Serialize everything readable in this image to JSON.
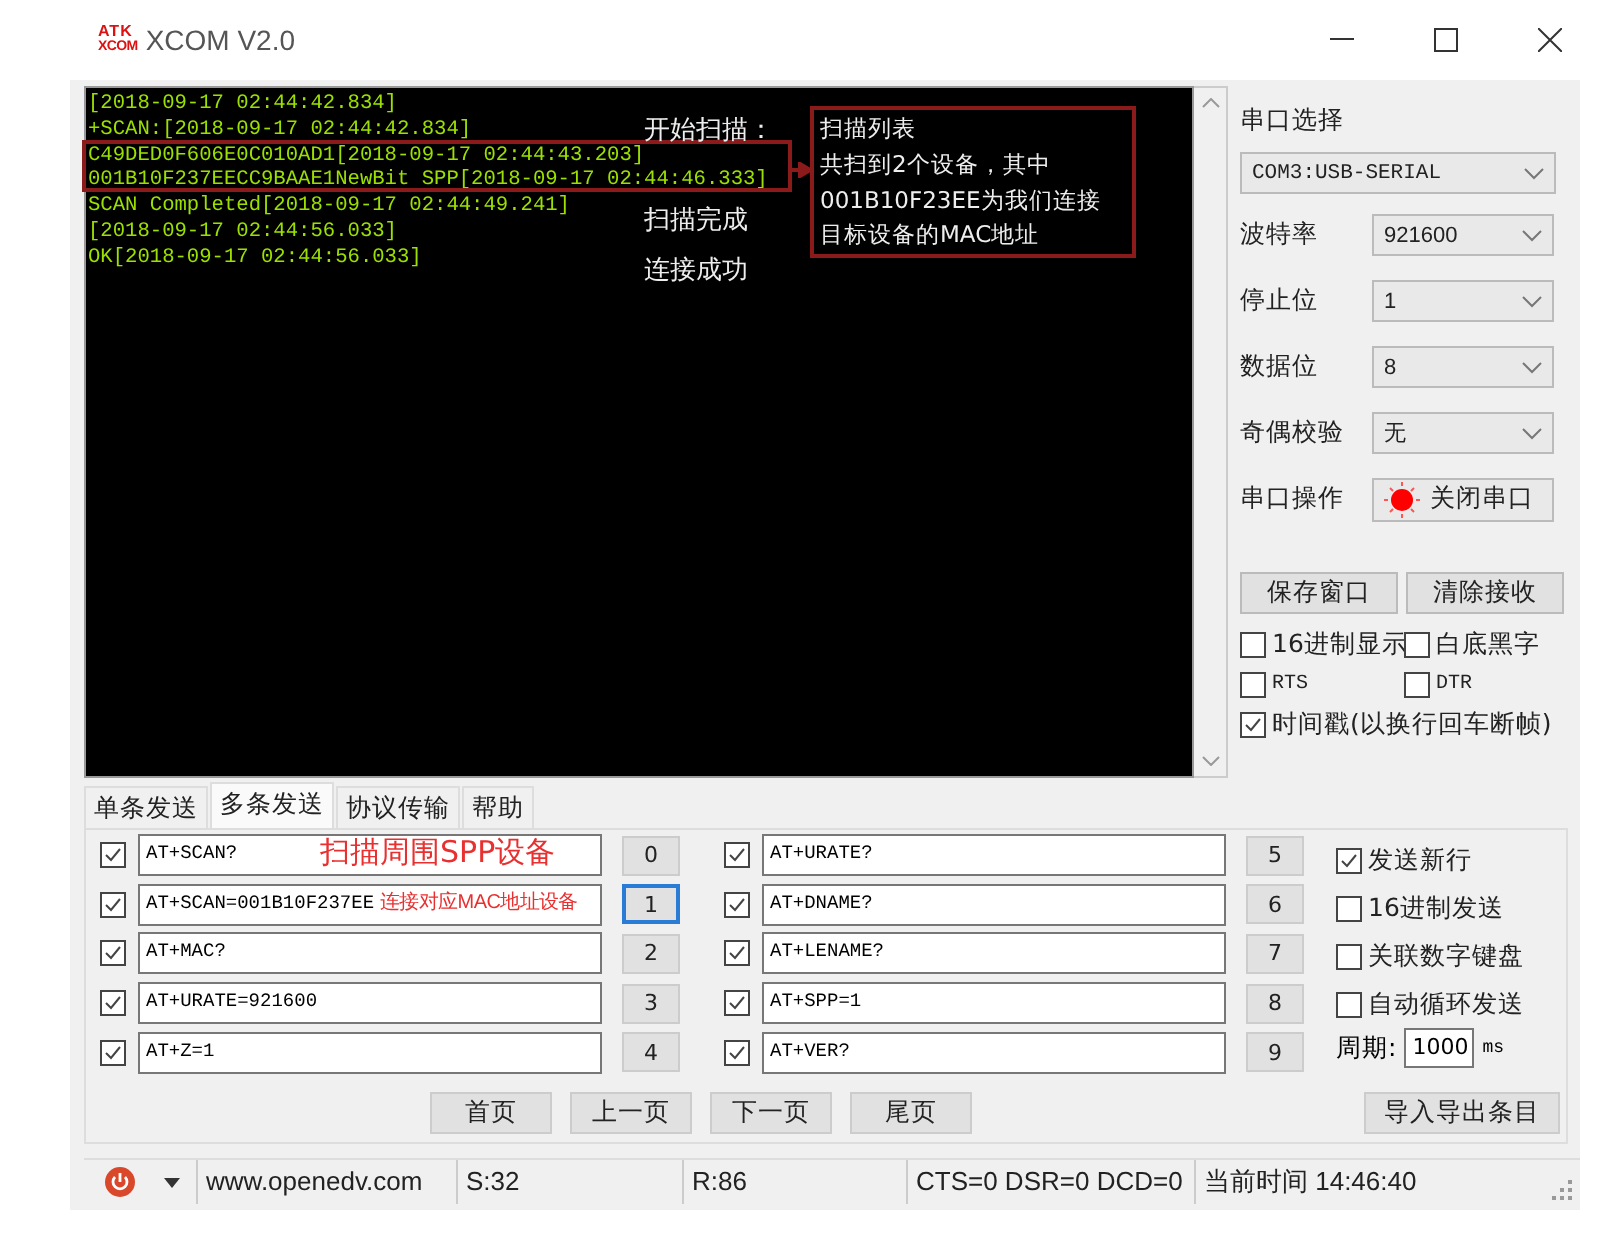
{
  "window": {
    "logo_top": "ATK",
    "logo_bottom": "XCOM",
    "title": "XCOM V2.0"
  },
  "terminal": {
    "lines": [
      "[2018-09-17 02:44:42.834]",
      "+SCAN:[2018-09-17 02:44:42.834]",
      "C49DED0F606E0C010AD1[2018-09-17 02:44:43.203]",
      "001B10F237EECC9BAAE1NewBit SPP[2018-09-17 02:44:46.333]",
      "SCAN Completed[2018-09-17 02:44:49.241]",
      "[2018-09-17 02:44:56.033]",
      "OK[2018-09-17 02:44:56.033]"
    ],
    "notes": [
      "开始扫描：",
      "扫描完成",
      "连接成功"
    ],
    "callout": [
      "扫描列表",
      "共扫到2个设备，其中",
      "001B10F23EE为我们连接",
      "目标设备的MAC地址"
    ]
  },
  "settings": {
    "port_label": "串口选择",
    "port": "COM3:USB-SERIAL",
    "fields": [
      {
        "label": "波特率",
        "value": "921600"
      },
      {
        "label": "停止位",
        "value": "1"
      },
      {
        "label": "数据位",
        "value": "8"
      },
      {
        "label": "奇偶校验",
        "value": "无"
      }
    ],
    "op_label": "串口操作",
    "op_button": "关闭串口",
    "port_open": true,
    "save_button": "保存窗口",
    "clear_button": "清除接收",
    "options": [
      {
        "label": "16进制显示",
        "checked": false
      },
      {
        "label": "白底黑字",
        "checked": false
      },
      {
        "label": "RTS",
        "checked": false
      },
      {
        "label": "DTR",
        "checked": false
      },
      {
        "label": "时间戳(以换行回车断帧)",
        "checked": true
      }
    ]
  },
  "tabs": [
    {
      "label": "单条发送",
      "selected": false
    },
    {
      "label": "多条发送",
      "selected": true
    },
    {
      "label": "协议传输",
      "selected": false
    },
    {
      "label": "帮助",
      "selected": false
    }
  ],
  "commands": [
    {
      "checked": true,
      "text": "AT+SCAN?",
      "button": "0",
      "focused": false
    },
    {
      "checked": true,
      "text": "AT+SCAN=001B10F237EE",
      "button": "1",
      "focused": true
    },
    {
      "checked": true,
      "text": "AT+MAC?",
      "button": "2",
      "focused": false
    },
    {
      "checked": true,
      "text": "AT+URATE=921600",
      "button": "3",
      "focused": false
    },
    {
      "checked": true,
      "text": "AT+Z=1",
      "button": "4",
      "focused": false
    },
    {
      "checked": true,
      "text": "AT+URATE?",
      "button": "5",
      "focused": false
    },
    {
      "checked": true,
      "text": "AT+DNAME?",
      "button": "6",
      "focused": false
    },
    {
      "checked": true,
      "text": "AT+LENAME?",
      "button": "7",
      "focused": false
    },
    {
      "checked": true,
      "text": "AT+SPP=1",
      "button": "8",
      "focused": false
    },
    {
      "checked": true,
      "text": "AT+VER?",
      "button": "9",
      "focused": false
    }
  ],
  "red_notes": [
    "扫描周围SPP设备",
    "连接对应MAC地址设备"
  ],
  "send_options": [
    {
      "label": "发送新行",
      "checked": true
    },
    {
      "label": "16进制发送",
      "checked": false
    },
    {
      "label": "关联数字键盘",
      "checked": false
    },
    {
      "label": "自动循环发送",
      "checked": false
    }
  ],
  "period_label": "周期:",
  "period": "1000",
  "period_unit": "ms",
  "page_buttons": [
    "首页",
    "上一页",
    "下一页",
    "尾页"
  ],
  "import_export": "导入导出条目",
  "status_bar": {
    "url": "www.openedv.com",
    "sent": "S:32",
    "received": "R:86",
    "signals": "CTS=0 DSR=0 DCD=0",
    "time": "当前时间 14:46:40"
  }
}
